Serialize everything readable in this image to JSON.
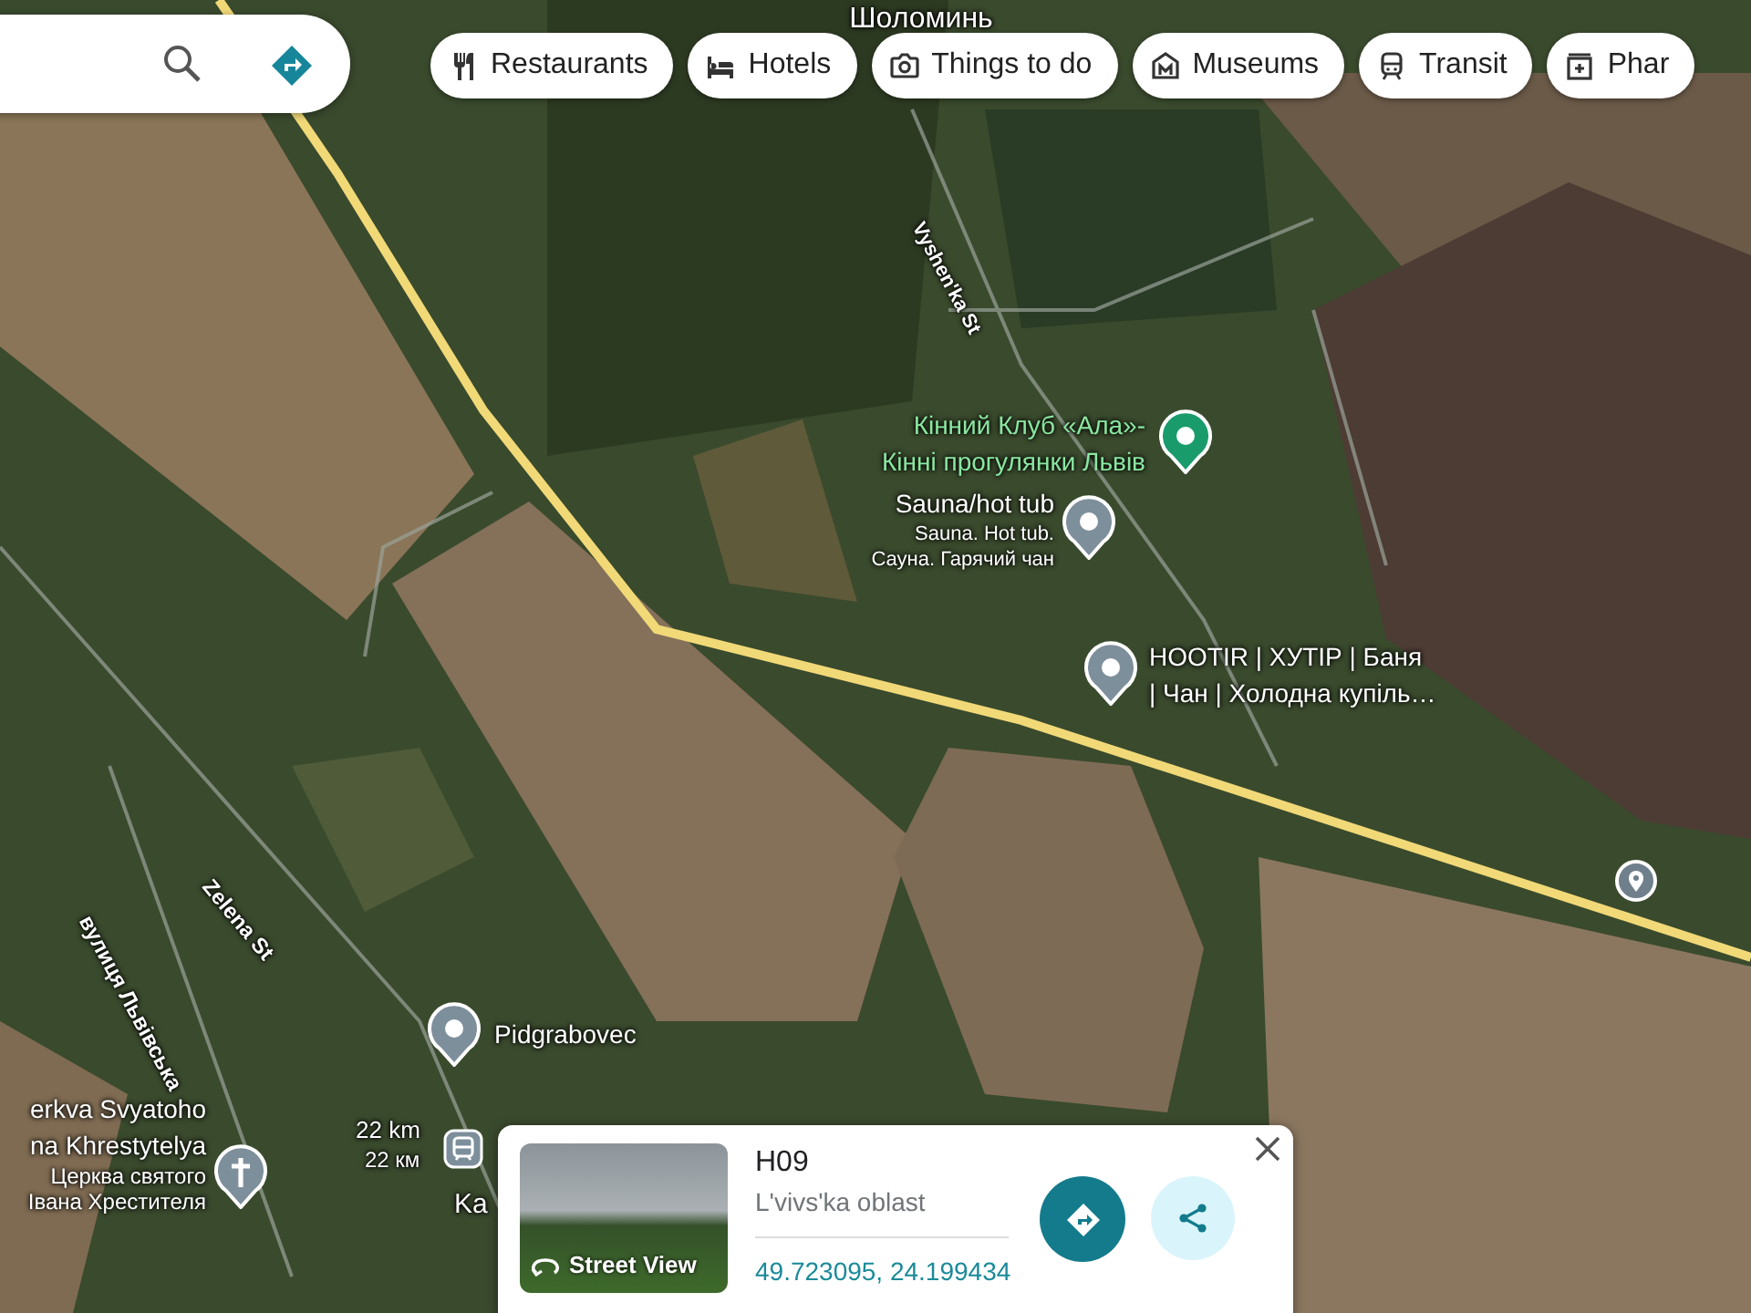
{
  "categories": [
    {
      "label": "Restaurants",
      "kind": "restaurant"
    },
    {
      "label": "Hotels",
      "kind": "hotel"
    },
    {
      "label": "Things to do",
      "kind": "camera"
    },
    {
      "label": "Museums",
      "kind": "museum"
    },
    {
      "label": "Transit",
      "kind": "transit"
    },
    {
      "label": "Phar",
      "kind": "pharmacy"
    }
  ],
  "map_labels": [
    {
      "text": "Шоломинь",
      "kind": "town"
    },
    {
      "text": "Vyshen'ka St",
      "kind": "street"
    },
    {
      "text": "вулиця Львівська",
      "kind": "street"
    },
    {
      "text": "Zelena St",
      "kind": "street"
    },
    {
      "text": "22 km",
      "kind": "distance"
    },
    {
      "text": "22 км",
      "kind": "distance"
    },
    {
      "text": "Ka",
      "kind": "town"
    }
  ],
  "places": [
    {
      "name": [
        "Кінний Клуб «Ала»-",
        "Кінні прогулянки Львів"
      ],
      "kind": "place",
      "color": "#1a9b6c"
    },
    {
      "name": [
        "Sauna/hot tub"
      ],
      "details": [
        "Sauna. Hot tub.",
        "Сауна. Гарячий чан"
      ],
      "kind": "place",
      "color": "#7e8f9c"
    },
    {
      "name": [
        "HOOTIR | ХУТІР | Баня",
        "| Чан | Холодна купіль…"
      ],
      "kind": "place",
      "color": "#7e8f9c"
    },
    {
      "name": [
        "Pidgrabovec"
      ],
      "kind": "place",
      "color": "#7e8f9c"
    },
    {
      "name": [
        "erkva Svyatoho",
        "na Khrestytelya"
      ],
      "details": [
        "Церква святого",
        "Івана Хрестителя"
      ],
      "kind": "church",
      "color": "#7e8f9c"
    }
  ],
  "info_card": {
    "photo_label": "Street View",
    "title": "H09",
    "subtitle": "L'vivs'ka oblast",
    "coordinates": "49.723095, 24.199434"
  }
}
